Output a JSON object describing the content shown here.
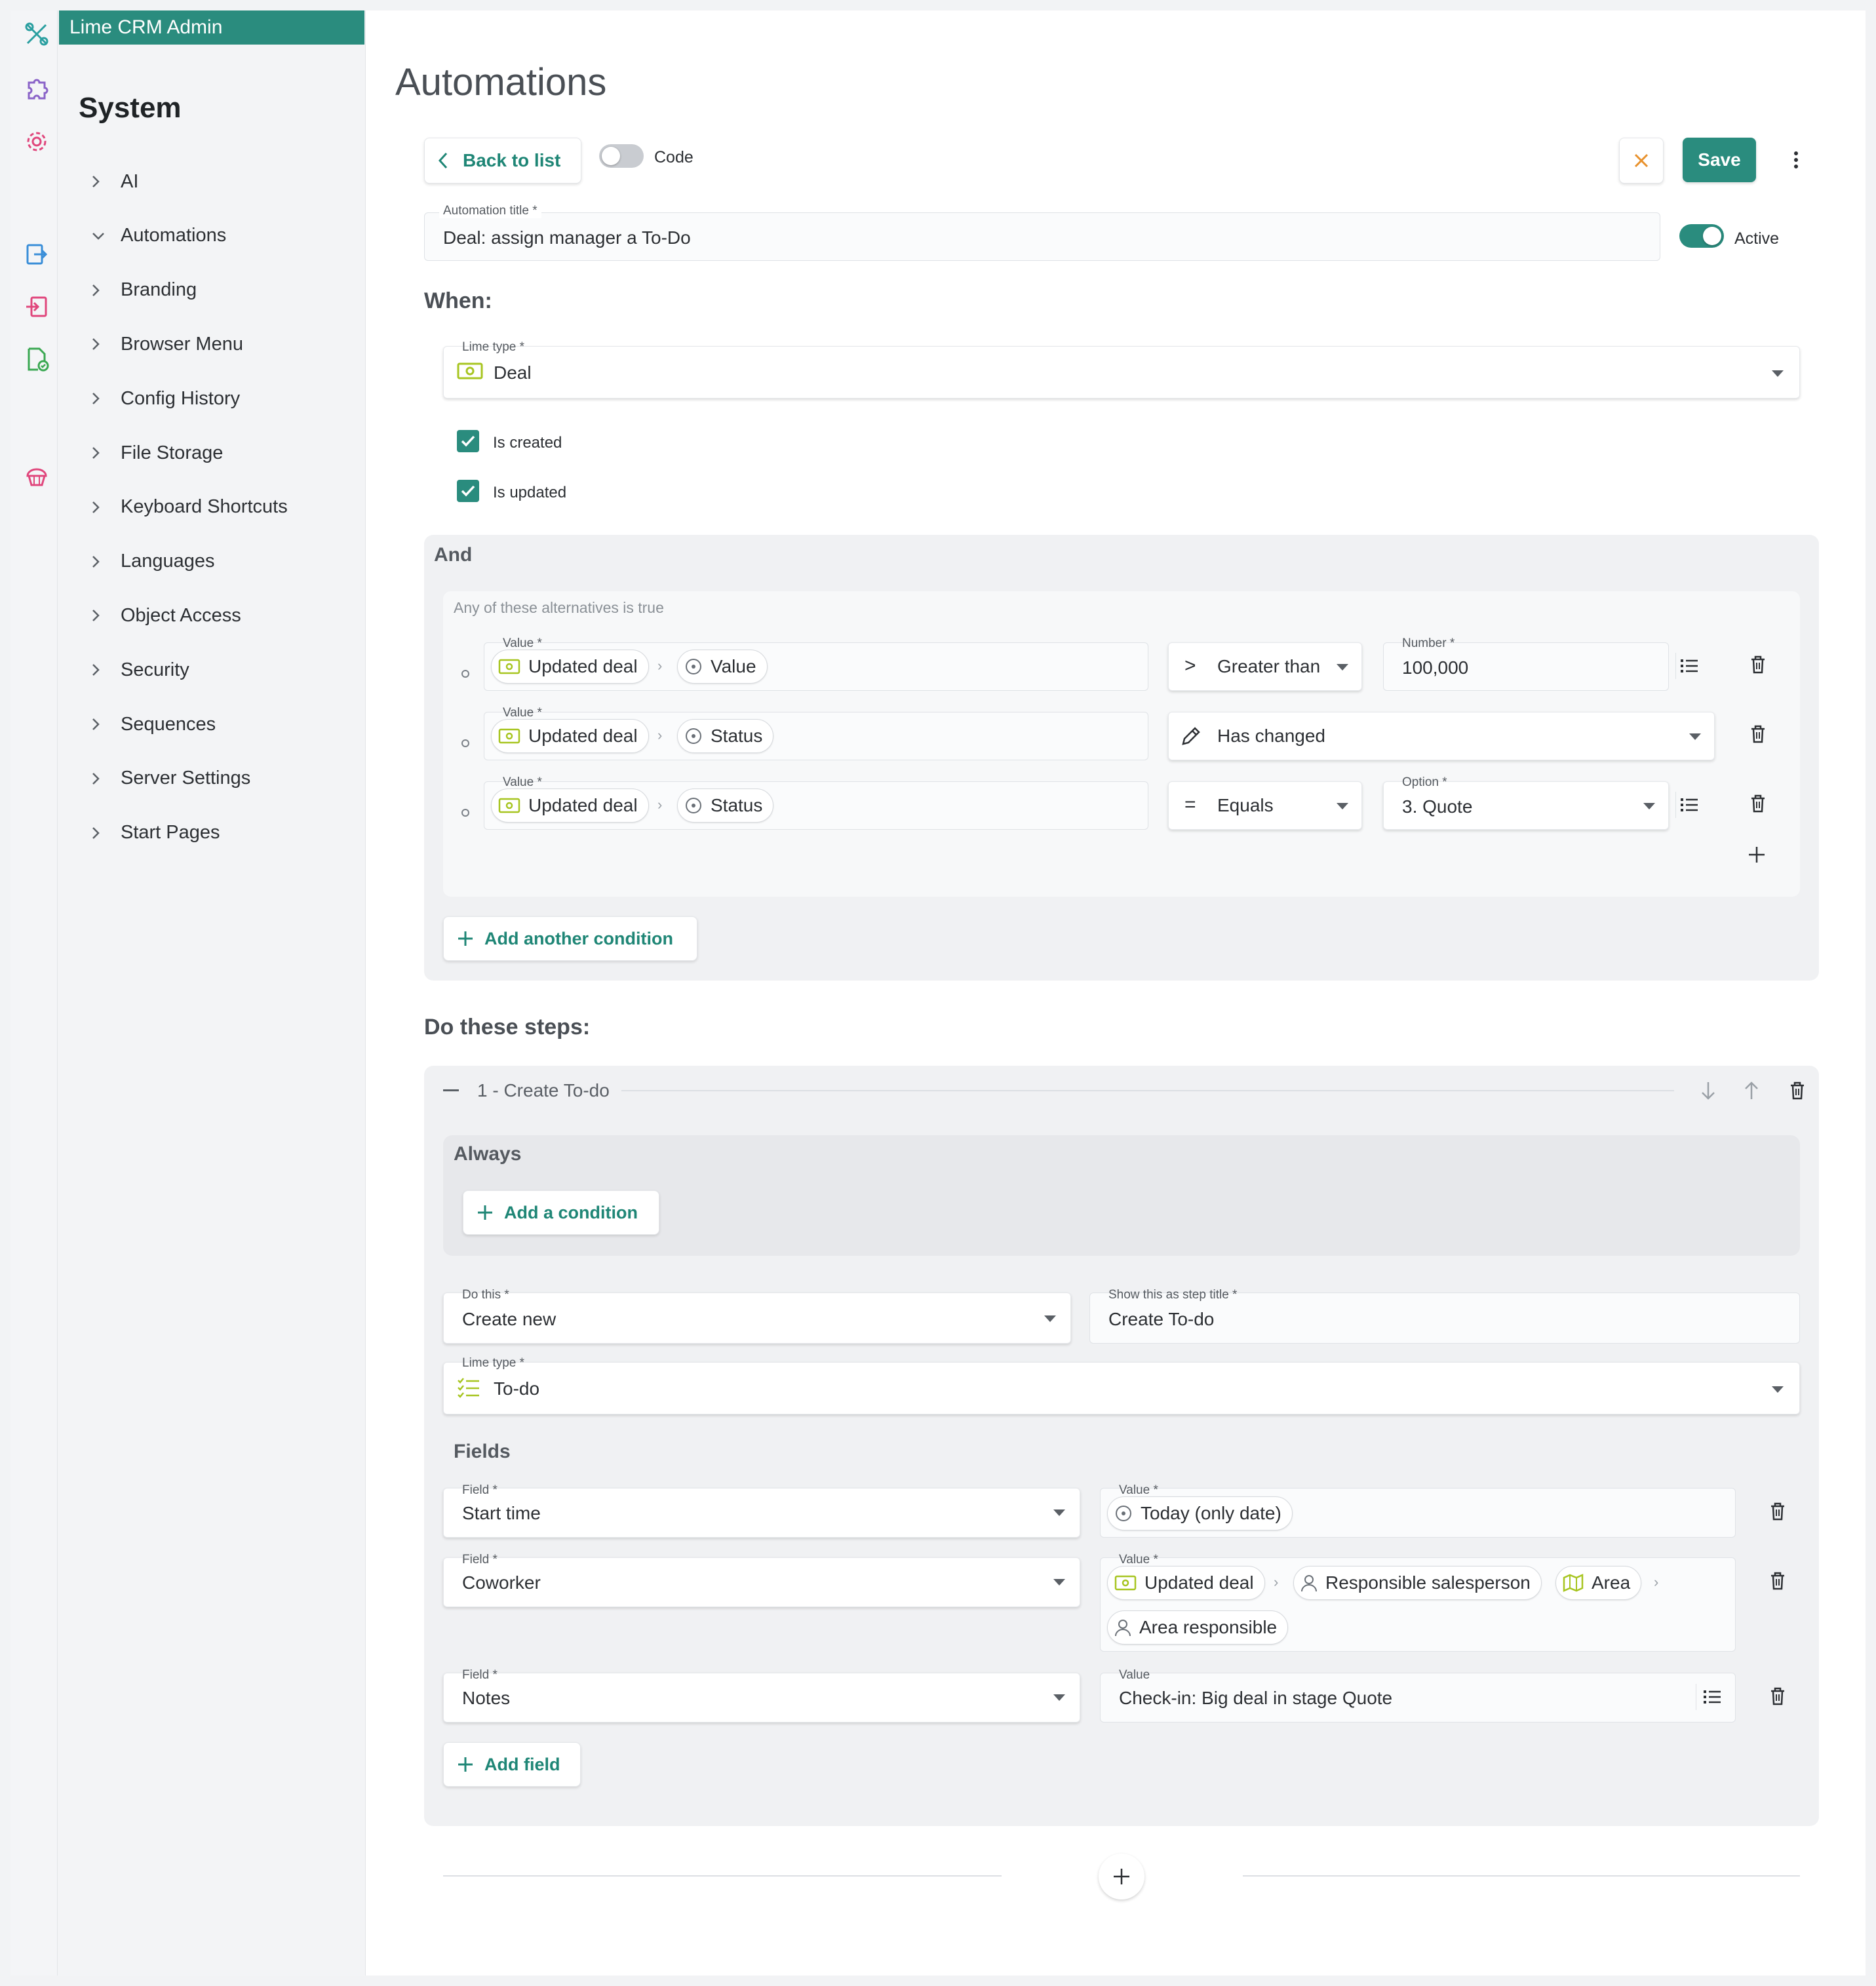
{
  "app": {
    "title": "Lime CRM Admin"
  },
  "colors": {
    "accent": "#2a8c7e",
    "close": "#e8912c",
    "pink": "#e0467c",
    "lime": "#a7c520"
  },
  "rail": {
    "icons": [
      "tools-icon",
      "puzzle-icon",
      "gear-icon",
      "export-icon",
      "import-icon",
      "file-check-icon",
      "cupcake-icon"
    ]
  },
  "nav": {
    "title": "System",
    "items": [
      {
        "label": "AI",
        "expanded": false
      },
      {
        "label": "Automations",
        "expanded": true
      },
      {
        "label": "Branding",
        "expanded": false
      },
      {
        "label": "Browser Menu",
        "expanded": false
      },
      {
        "label": "Config History",
        "expanded": false
      },
      {
        "label": "File Storage",
        "expanded": false
      },
      {
        "label": "Keyboard Shortcuts",
        "expanded": false
      },
      {
        "label": "Languages",
        "expanded": false
      },
      {
        "label": "Object Access",
        "expanded": false
      },
      {
        "label": "Security",
        "expanded": false
      },
      {
        "label": "Sequences",
        "expanded": false
      },
      {
        "label": "Server Settings",
        "expanded": false
      },
      {
        "label": "Start Pages",
        "expanded": false
      }
    ]
  },
  "page": {
    "title": "Automations"
  },
  "toolbar": {
    "back_label": "Back to list",
    "code_label": "Code",
    "code_on": false,
    "save_label": "Save"
  },
  "automation": {
    "title_label": "Automation title *",
    "title_value": "Deal: assign manager a To-Do",
    "active_label": "Active",
    "active_on": true
  },
  "when": {
    "heading": "When:",
    "limetype_label": "Lime type *",
    "limetype_value": "Deal",
    "is_created": "Is created",
    "is_updated": "Is updated"
  },
  "and_section": {
    "heading": "And",
    "subtitle": "Any of these alternatives is true",
    "rows": [
      {
        "value_label": "Value *",
        "chip1": "Updated deal",
        "chip2": "Value",
        "operator": "Greater than",
        "operator_symbol": ">",
        "right_label": "Number *",
        "right_value": "100,000"
      },
      {
        "value_label": "Value *",
        "chip1": "Updated deal",
        "chip2": "Status",
        "operator": "Has changed"
      },
      {
        "value_label": "Value *",
        "chip1": "Updated deal",
        "chip2": "Status",
        "operator": "Equals",
        "operator_symbol": "=",
        "right_label": "Option *",
        "right_value": "3. Quote"
      }
    ],
    "add_condition_label": "Add another condition"
  },
  "steps": {
    "heading": "Do these steps:",
    "step_title": "1 - Create To-do",
    "always_label": "Always",
    "add_a_condition_label": "Add a condition",
    "do_this_label": "Do this *",
    "do_this_value": "Create new",
    "step_title_label": "Show this as step title *",
    "step_title_value": "Create To-do",
    "limetype_label": "Lime type *",
    "limetype_value": "To-do",
    "fields_heading": "Fields",
    "fields": [
      {
        "field_label": "Field *",
        "field_value": "Start time",
        "value_label": "Value *",
        "chips": [
          "Today (only date)"
        ]
      },
      {
        "field_label": "Field *",
        "field_value": "Coworker",
        "value_label": "Value *",
        "chips": [
          "Updated deal",
          "Responsible salesperson",
          "Area",
          "Area responsible"
        ]
      },
      {
        "field_label": "Field *",
        "field_value": "Notes",
        "value_label": "Value",
        "text": "Check-in: Big deal in stage Quote"
      }
    ],
    "add_field_label": "Add field"
  }
}
